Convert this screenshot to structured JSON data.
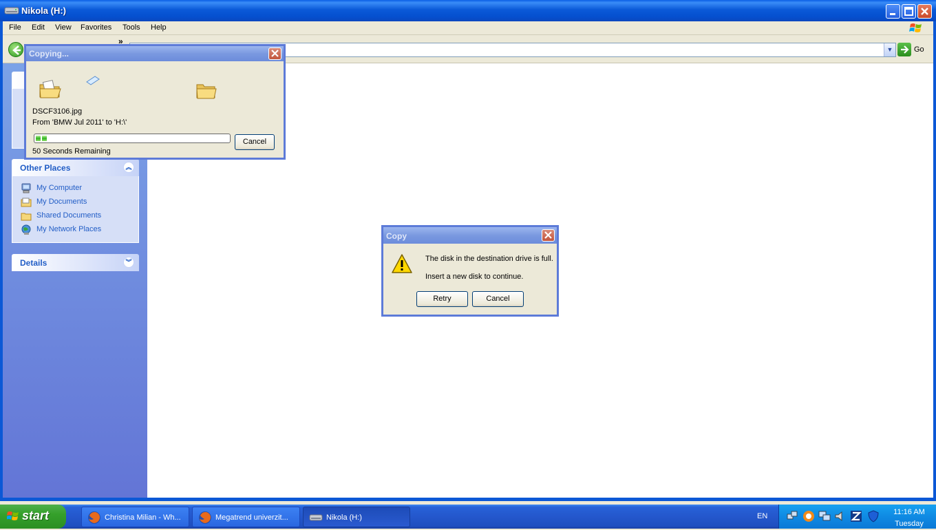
{
  "window": {
    "title": "Nikola (H:)"
  },
  "menu": [
    "File",
    "Edit",
    "View",
    "Favorites",
    "Tools",
    "Help"
  ],
  "address_bar": {
    "go_label": "Go"
  },
  "other_places": {
    "title": "Other Places",
    "items": [
      "My Computer",
      "My Documents",
      "Shared Documents",
      "My Network Places"
    ]
  },
  "details": {
    "title": "Details"
  },
  "copying_dialog": {
    "title": "Copying...",
    "filename": "DSCF3106.jpg",
    "from_to": "From 'BMW Jul 2011' to 'H:\\'",
    "remaining": "50 Seconds Remaining",
    "cancel_label": "Cancel",
    "progress_fraction": 0.06
  },
  "copy_error_dialog": {
    "title": "Copy",
    "message": "The disk in the destination drive is full.",
    "sub_message": "Insert a new disk to continue.",
    "retry_label": "Retry",
    "cancel_label": "Cancel"
  },
  "taskbar": {
    "start_label": "start",
    "tasks": [
      "Christina Milian - Wh...",
      "Megatrend univerzit...",
      "Nikola (H:)"
    ],
    "language": "EN",
    "time": "11:16 AM",
    "day": "Tuesday"
  },
  "colors": {
    "titlebar_blue": "#0b5ad8",
    "taskpane_blue": "#6f8ce0",
    "link_blue": "#215dc6",
    "progress_green": "#30b520"
  }
}
